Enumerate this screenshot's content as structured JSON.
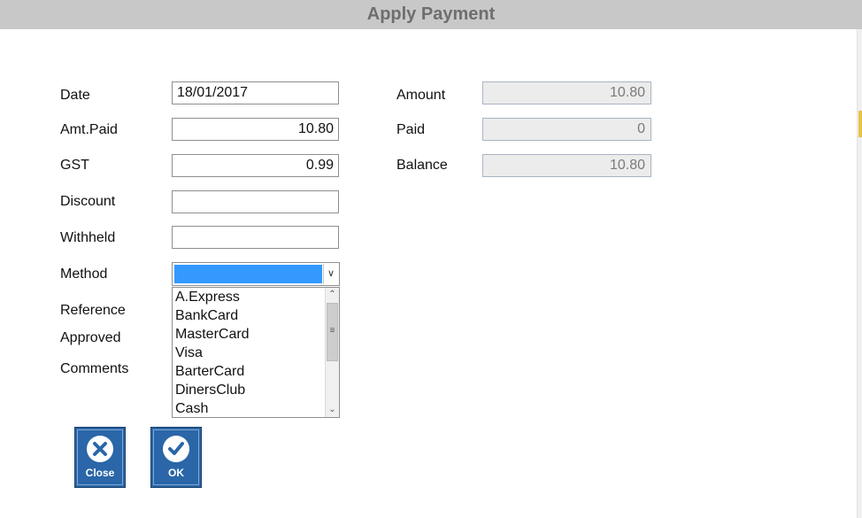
{
  "window": {
    "title": "Apply Payment"
  },
  "form": {
    "date_label": "Date",
    "date_value": "18/01/2017",
    "amt_paid_label": "Amt.Paid",
    "amt_paid_value": "10.80",
    "gst_label": "GST",
    "gst_value": "0.99",
    "discount_label": "Discount",
    "discount_value": "",
    "withheld_label": "Withheld",
    "withheld_value": "",
    "method_label": "Method",
    "method_value": "",
    "reference_label": "Reference",
    "approved_label": "Approved",
    "comments_label": "Comments"
  },
  "summary": {
    "amount_label": "Amount",
    "amount_value": "10.80",
    "paid_label": "Paid",
    "paid_value": "0",
    "balance_label": "Balance",
    "balance_value": "10.80"
  },
  "method_options": [
    "A.Express",
    "BankCard",
    "MasterCard",
    "Visa",
    "BarterCard",
    "DinersClub",
    "Cash"
  ],
  "buttons": {
    "close_label": "Close",
    "ok_label": "OK"
  },
  "colors": {
    "title_bar": "#c8c8c8",
    "selection": "#3399ff",
    "button_blue": "#2a66a8"
  },
  "icons": {
    "close": "close-circle-icon",
    "ok": "check-circle-icon",
    "combo": "chevron-down-icon"
  }
}
